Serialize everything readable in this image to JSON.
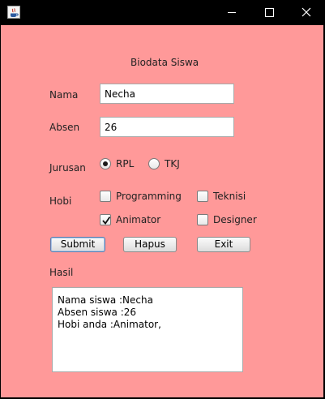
{
  "window": {
    "title": "",
    "controls": [
      "minimize-icon",
      "maximize-icon",
      "close-icon"
    ],
    "colors": {
      "titlebar": "#000000",
      "background": "#ff9999"
    }
  },
  "form": {
    "heading": "Biodata Siswa",
    "nama": {
      "label": "Nama",
      "value": "Necha"
    },
    "absen": {
      "label": "Absen",
      "value": "26"
    },
    "jurusan": {
      "label": "Jurusan",
      "options": [
        {
          "label": "RPL",
          "selected": true
        },
        {
          "label": "TKJ",
          "selected": false
        }
      ]
    },
    "hobi": {
      "label": "Hobi",
      "options": [
        {
          "label": "Programming",
          "checked": false
        },
        {
          "label": "Teknisi",
          "checked": false
        },
        {
          "label": "Animator",
          "checked": true
        },
        {
          "label": "Designer",
          "checked": false
        }
      ]
    },
    "buttons": {
      "submit": "Submit",
      "hapus": "Hapus",
      "exit": "Exit"
    },
    "hasil": {
      "label": "Hasil",
      "lines": [
        "Nama siswa :Necha",
        "Absen siswa :26",
        "Hobi anda :Animator,"
      ]
    }
  }
}
